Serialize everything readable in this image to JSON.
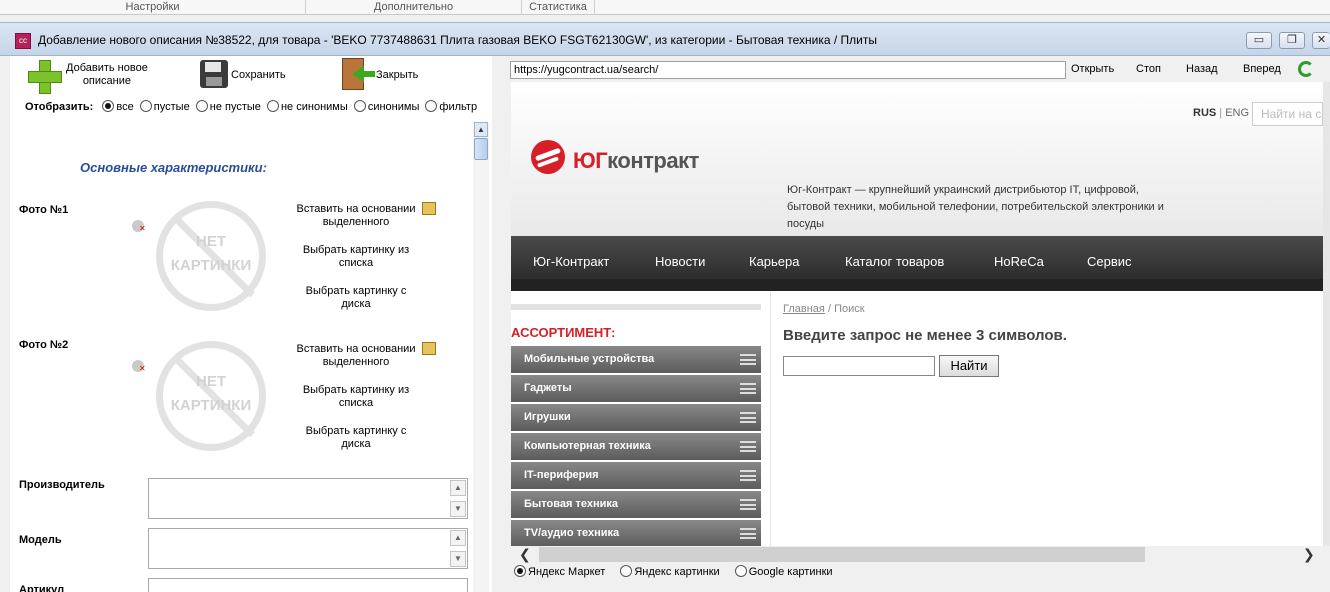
{
  "top_tabs": [
    "Настройки",
    "Дополнительно",
    "Статистика"
  ],
  "window": {
    "icon_text": "cc",
    "title": "Добавление нового описания №38522, для товара - 'BEKO 7737488631 Плита газовая BEKO FSGT62130GW', из категории - Бытовая техника / Плиты",
    "btn_minimize": "▭",
    "btn_restore": "❐",
    "btn_close": "✕"
  },
  "toolbar": {
    "add_label_1": "Добавить новое",
    "add_label_2": "описание",
    "save_label": "Сохранить",
    "close_label": "Закрыть"
  },
  "filter": {
    "label": "Отобразить:",
    "options": [
      "все",
      "пустые",
      "не пустые",
      "не синонимы",
      "синонимы",
      "фильтр"
    ],
    "selected": "все"
  },
  "section_title": "Основные характеристики:",
  "photos": [
    {
      "label": "Фото №1",
      "placeholder_line1": "НЕТ",
      "placeholder_line2": "КАРТИНКИ",
      "paste_1": "Вставить на основании",
      "paste_2": "выделенного",
      "list_1": "Выбрать картинку из",
      "list_2": "списка",
      "disk_1": "Выбрать картинку с",
      "disk_2": "диска"
    },
    {
      "label": "Фото №2",
      "placeholder_line1": "НЕТ",
      "placeholder_line2": "КАРТИНКИ",
      "paste_1": "Вставить на основании",
      "paste_2": "выделенного",
      "list_1": "Выбрать картинку из",
      "list_2": "списка",
      "disk_1": "Выбрать картинку с",
      "disk_2": "диска"
    }
  ],
  "fields": [
    {
      "label": "Производитель",
      "value": ""
    },
    {
      "label": "Модель",
      "value": ""
    },
    {
      "label": "Артикул",
      "value": ""
    }
  ],
  "browser": {
    "url": "https://yugcontract.ua/search/",
    "btn_open": "Открыть",
    "btn_stop": "Стоп",
    "btn_back": "Назад",
    "btn_forward": "Вперед"
  },
  "site": {
    "lang_rus": "RUS",
    "lang_sep": "|",
    "lang_eng": "ENG",
    "search_placeholder": "Найти на сайте",
    "logo_part1": "ЮГ",
    "logo_part2": "контракт",
    "tagline": "Юг-Контракт — крупнейший украинский дистрибьютор IT, цифровой, бытовой техники, мобильной телефонии, потребительской электроники и посуды",
    "nav": [
      "Юг-Контракт",
      "Новости",
      "Карьера",
      "Каталог товаров",
      "HoReCa",
      "Сервис"
    ],
    "assortment_title": "АССОРТИМЕНТ:",
    "categories": [
      "Мобильные устройства",
      "Гаджеты",
      "Игрушки",
      "Компьютерная техника",
      "IT-периферия",
      "Бытовая техника",
      "TV/аудио техника"
    ],
    "breadcrumb_home": "Главная",
    "breadcrumb_sep": "/",
    "breadcrumb_current": "Поиск",
    "query_message": "Введите запрос не менее 3 символов.",
    "query_value": "",
    "find_button": "Найти"
  },
  "search_sources": {
    "options": [
      "Яндекс Маркет",
      "Яндекс картинки",
      "Google картинки"
    ],
    "selected": "Яндекс Маркет"
  }
}
